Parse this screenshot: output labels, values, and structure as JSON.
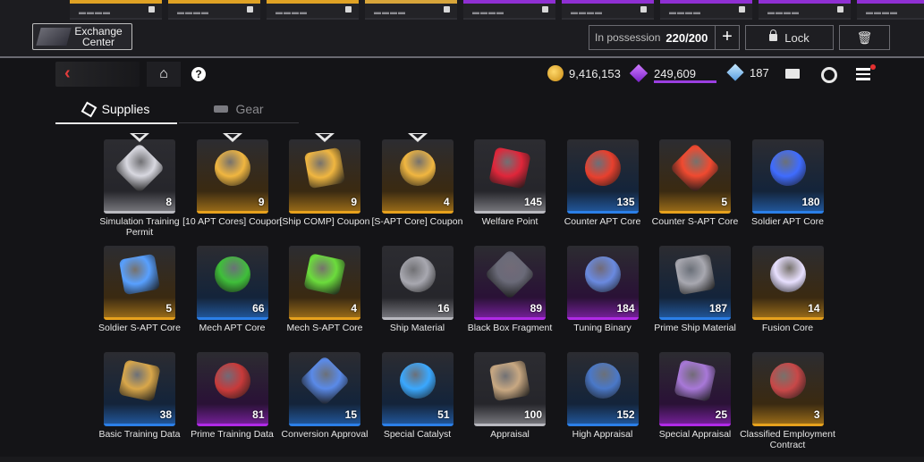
{
  "top": {
    "strip_colors": [
      "#e0a224",
      "#e0a224",
      "#e0a224",
      "#d8a53a",
      "#8f2fd3",
      "#8f2fd3",
      "#8f2fd3",
      "#8f2fd3",
      "#8f2fd3"
    ],
    "exchange_label": "Exchange Center",
    "possession_label": "In possession",
    "possession_value": "220/200",
    "plus_glyph": "+",
    "lock_label": "Lock",
    "trash_glyph": "🗑"
  },
  "header": {
    "back_glyph": "‹",
    "home_glyph": "⌂",
    "help_glyph": "?",
    "gold": "9,416,153",
    "crystal": "249,609",
    "diamond": "187"
  },
  "tabs": [
    {
      "label": "Supplies",
      "active": true
    },
    {
      "label": "Gear",
      "active": false
    }
  ],
  "items": [
    {
      "name": "Simulation Training Permit",
      "count": "8",
      "rarity": "gray",
      "badge": true,
      "icon": "m-permit-icon"
    },
    {
      "name": "[10 APT Cores] Coupon",
      "count": "9",
      "rarity": "gold",
      "badge": true,
      "icon": "gold-coupon-icon"
    },
    {
      "name": "[Ship COMP] Coupon",
      "count": "9",
      "rarity": "gold",
      "badge": true,
      "icon": "gold-coupon-icon"
    },
    {
      "name": "[S-APT Core] Coupon",
      "count": "4",
      "rarity": "gold",
      "badge": true,
      "icon": "gold-coupon-icon"
    },
    {
      "name": "Welfare Point",
      "count": "145",
      "rarity": "gray",
      "badge": false,
      "icon": "red-crystal-icon"
    },
    {
      "name": "Counter APT Core",
      "count": "135",
      "rarity": "blue",
      "badge": false,
      "icon": "red-core-icon"
    },
    {
      "name": "Counter S-APT Core",
      "count": "5",
      "rarity": "gold",
      "badge": false,
      "icon": "red-star-core-icon"
    },
    {
      "name": "Soldier APT Core",
      "count": "180",
      "rarity": "blue",
      "badge": false,
      "icon": "blue-core-icon"
    },
    {
      "name": "Soldier S-APT Core",
      "count": "5",
      "rarity": "gold",
      "badge": false,
      "icon": "blue-star-core-icon"
    },
    {
      "name": "Mech APT Core",
      "count": "66",
      "rarity": "blue",
      "badge": false,
      "icon": "green-core-icon"
    },
    {
      "name": "Mech S-APT Core",
      "count": "4",
      "rarity": "gold",
      "badge": false,
      "icon": "green-star-core-icon"
    },
    {
      "name": "Ship Material",
      "count": "16",
      "rarity": "gray",
      "badge": false,
      "icon": "gear-part-icon"
    },
    {
      "name": "Black Box Fragment",
      "count": "89",
      "rarity": "purple",
      "badge": false,
      "icon": "black-box-icon"
    },
    {
      "name": "Tuning Binary",
      "count": "184",
      "rarity": "purple",
      "badge": false,
      "icon": "blueprint-icon"
    },
    {
      "name": "Prime Ship Material",
      "count": "187",
      "rarity": "blue",
      "badge": false,
      "icon": "gear-part-icon"
    },
    {
      "name": "Fusion Core",
      "count": "14",
      "rarity": "gold",
      "badge": false,
      "icon": "white-crystal-icon"
    },
    {
      "name": "Basic Training Data",
      "count": "38",
      "rarity": "blue",
      "badge": false,
      "icon": "folder-icon"
    },
    {
      "name": "Prime Training Data",
      "count": "81",
      "rarity": "purple",
      "badge": false,
      "icon": "red-folder-icon"
    },
    {
      "name": "Conversion Approval",
      "count": "15",
      "rarity": "blue",
      "badge": false,
      "icon": "card-icon"
    },
    {
      "name": "Special Catalyst",
      "count": "51",
      "rarity": "blue",
      "badge": false,
      "icon": "battery-icon"
    },
    {
      "name": "Appraisal",
      "count": "100",
      "rarity": "gray",
      "badge": false,
      "icon": "envelope-icon"
    },
    {
      "name": "High Appraisal",
      "count": "152",
      "rarity": "blue",
      "badge": false,
      "icon": "blue-file-icon"
    },
    {
      "name": "Special Appraisal",
      "count": "25",
      "rarity": "purple",
      "badge": false,
      "icon": "purple-file-icon"
    },
    {
      "name": "Classified Employment Contract",
      "count": "3",
      "rarity": "gold",
      "badge": false,
      "icon": "contract-icon"
    }
  ],
  "colors": {
    "gold": "#e7a11d",
    "blue": "#2b7fe8",
    "purple": "#b02ae6",
    "gray": "#b9b9bf"
  }
}
